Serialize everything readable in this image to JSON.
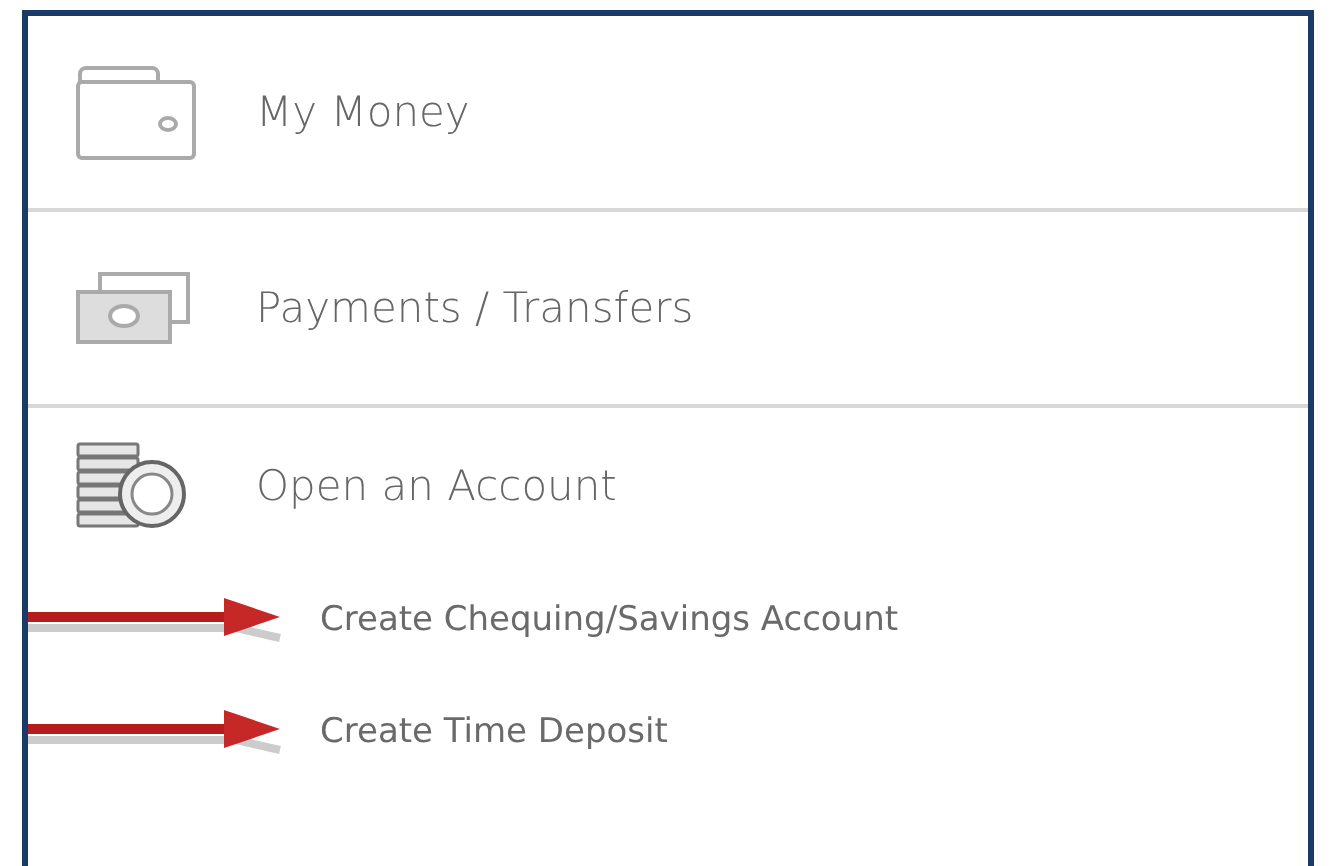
{
  "menu": [
    {
      "label": "My Money"
    },
    {
      "label": "Payments / Transfers"
    },
    {
      "label": "Open an Account",
      "children": [
        {
          "label": "Create Chequing/Savings Account",
          "arrow": true
        },
        {
          "label": "Create Time Deposit",
          "arrow": true
        }
      ]
    }
  ]
}
